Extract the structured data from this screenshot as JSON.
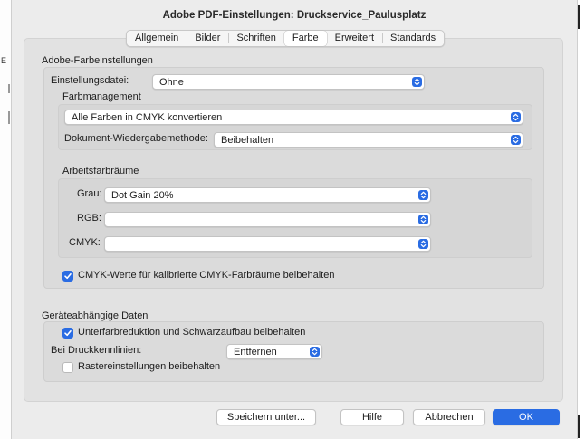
{
  "window": {
    "title": "Adobe PDF-Einstellungen: Druckservice_Paulusplatz"
  },
  "tabs": [
    {
      "label": "Allgemein",
      "active": false
    },
    {
      "label": "Bilder",
      "active": false
    },
    {
      "label": "Schriften",
      "active": false
    },
    {
      "label": "Farbe",
      "active": true
    },
    {
      "label": "Erweitert",
      "active": false
    },
    {
      "label": "Standards",
      "active": false
    }
  ],
  "color_settings": {
    "heading": "Adobe-Farbeinstellungen",
    "settings_file_label": "Einstellungsdatei:",
    "settings_file_value": "Ohne",
    "management": {
      "heading": "Farbmanagement",
      "policy_value": "Alle Farben in CMYK konvertieren",
      "intent_label": "Dokument-Wiedergabemethode:",
      "intent_value": "Beibehalten"
    },
    "working_spaces": {
      "heading": "Arbeitsfarbräume",
      "gray_label": "Grau:",
      "gray_value": "Dot Gain 20%",
      "rgb_label": "RGB:",
      "rgb_value": "",
      "cmyk_label": "CMYK:",
      "cmyk_value": ""
    },
    "preserve_cmyk_label": "CMYK-Werte für kalibrierte CMYK-Farbräume beibehalten",
    "preserve_cmyk_checked": true
  },
  "device_data": {
    "heading": "Geräteabhängige Daten",
    "ucr_label": "Unterfarbreduktion und Schwarzaufbau beibehalten",
    "ucr_checked": true,
    "transfer_label": "Bei Druckkennlinien:",
    "transfer_value": "Entfernen",
    "halftone_label": "Rastereinstellungen beibehalten",
    "halftone_checked": false
  },
  "buttons": {
    "save_as": "Speichern unter...",
    "help": "Hilfe",
    "cancel": "Abbrechen",
    "ok": "OK"
  },
  "colors": {
    "accent": "#2a6ce3",
    "window_bg": "#ececec",
    "panel_bg": "#e2e2e2"
  },
  "icons": {
    "popup": "chevron-up-down-icon",
    "checkbox": "checkmark-icon"
  }
}
